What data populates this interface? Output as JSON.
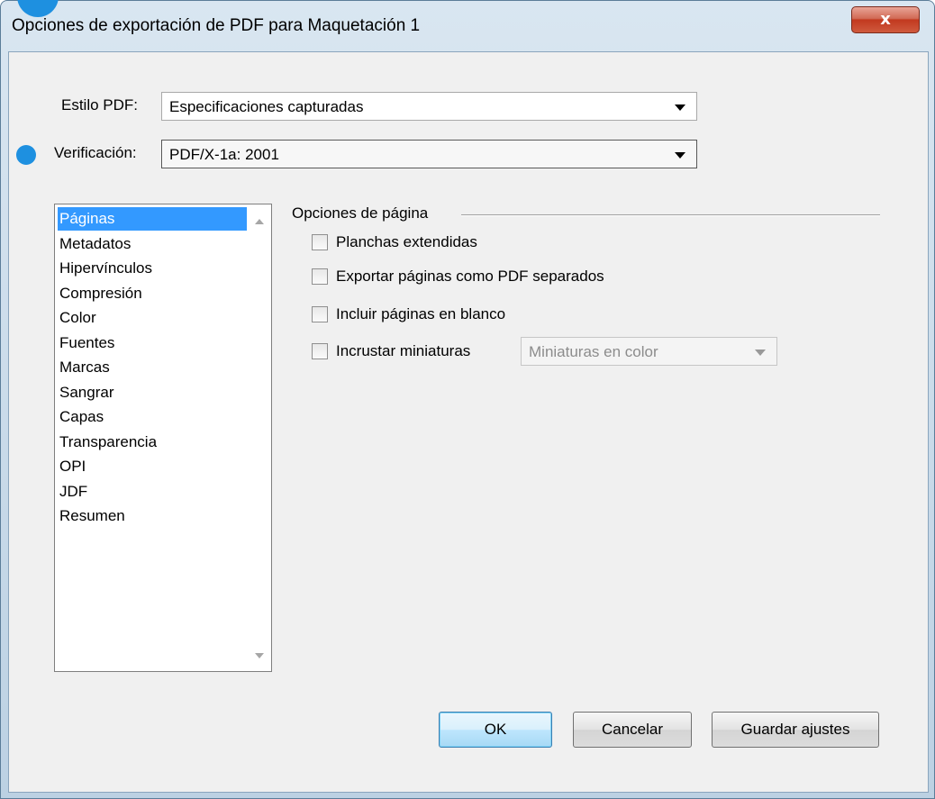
{
  "window": {
    "title": "Opciones de exportación de PDF para Maquetación 1",
    "close_label": "x"
  },
  "estilo": {
    "label": "Estilo PDF:",
    "value": "Especificaciones capturadas"
  },
  "verificacion": {
    "label": "Verificación:",
    "value": "PDF/X-1a: 2001"
  },
  "sidebar": {
    "items": [
      {
        "label": "Páginas"
      },
      {
        "label": "Metadatos"
      },
      {
        "label": "Hipervínculos"
      },
      {
        "label": "Compresión"
      },
      {
        "label": "Color"
      },
      {
        "label": "Fuentes"
      },
      {
        "label": "Marcas"
      },
      {
        "label": "Sangrar"
      },
      {
        "label": "Capas"
      },
      {
        "label": "Transparencia"
      },
      {
        "label": "OPI"
      },
      {
        "label": "JDF"
      },
      {
        "label": "Resumen"
      }
    ]
  },
  "page_options": {
    "title": "Opciones de página",
    "planchas": {
      "label": "Planchas extendidas",
      "checked": false
    },
    "exportar": {
      "label": "Exportar páginas como PDF separados",
      "checked": false
    },
    "incluir": {
      "label": "Incluir páginas en blanco",
      "checked": false
    },
    "incrustar": {
      "label": "Incrustar miniaturas",
      "checked": false
    },
    "miniaturas_select": {
      "value": "Miniaturas en color"
    }
  },
  "buttons": {
    "ok": "OK",
    "cancel": "Cancelar",
    "save": "Guardar ajustes"
  },
  "colors": {
    "selection": "#3399ff",
    "accent_dot": "#1e90e0",
    "close": "#c2391f"
  }
}
